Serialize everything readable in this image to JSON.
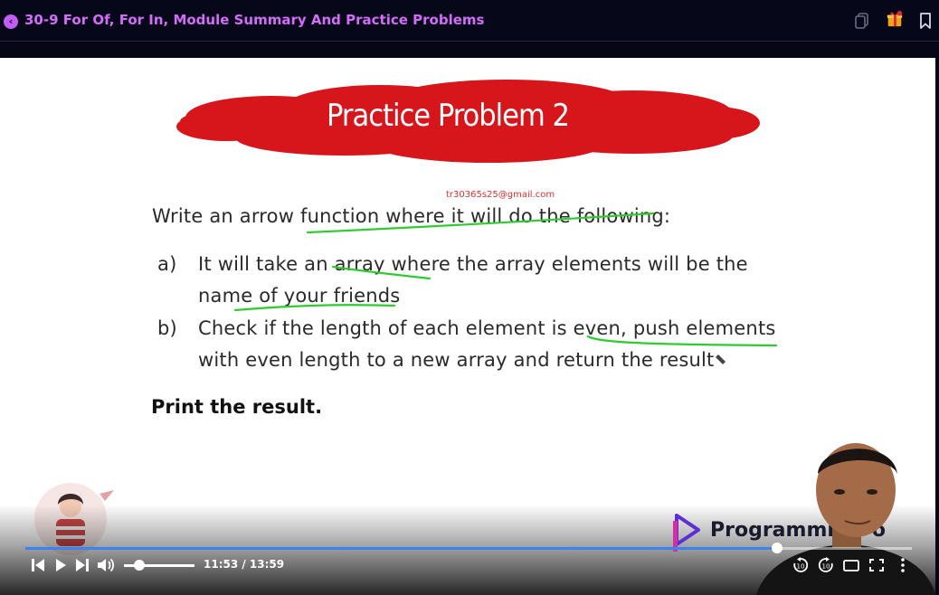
{
  "header": {
    "lesson_title": "30-9 For Of, For In, Module Summary And Practice Problems",
    "icons": [
      "back-icon",
      "copy-icon",
      "gift-icon",
      "bookmark-icon"
    ]
  },
  "slide": {
    "title": "Practice Problem 2",
    "watermark_email": "tr30365s25@gmail.com",
    "intro": "Write an arrow function where it will do the following:",
    "item_a_marker": "a)",
    "item_a_line1": "It will take an array where the array elements will be the",
    "item_a_line2": "name of your friends",
    "item_b_marker": "b)",
    "item_b_line1": "Check if the length of each element is even, push elements",
    "item_b_line2": "with even length to a new array and return the result",
    "closing": "Print the result.",
    "banner_color": "#d6161b",
    "annotation_color": "#2fcc2f"
  },
  "overlay": {
    "brand_text": "Programmi",
    "brand_suffix": "o",
    "brand_color": "#5b2fd4"
  },
  "player": {
    "time_display": "11:53 / 13:59",
    "progress_fraction": 0.848,
    "volume_fraction": 0.2,
    "accent_color": "#3b82f6",
    "left_controls": [
      "previous-icon",
      "play-icon",
      "next-icon",
      "volume-icon"
    ],
    "right_controls": [
      "rewind-10-icon",
      "forward-10-icon",
      "theater-mode-icon",
      "fullscreen-icon",
      "more-options-icon"
    ]
  }
}
